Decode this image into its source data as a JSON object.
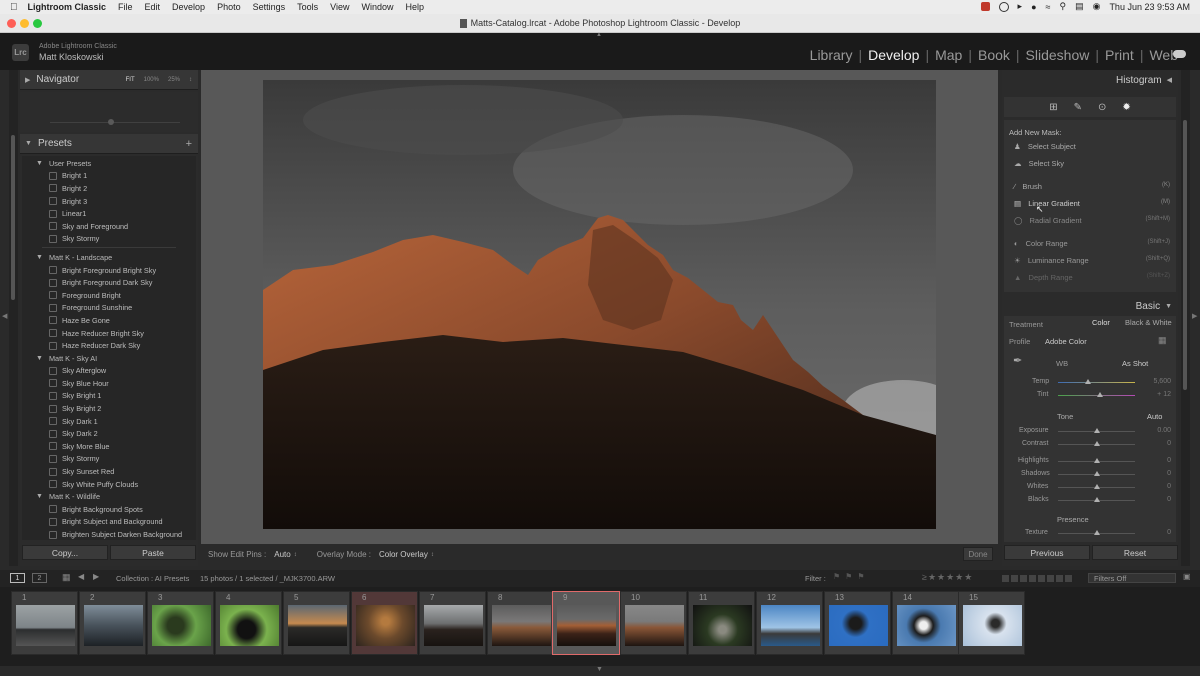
{
  "menubar": {
    "app": "Lightroom Classic",
    "items": [
      "File",
      "Edit",
      "Develop",
      "Photo",
      "Settings",
      "Tools",
      "View",
      "Window",
      "Help"
    ],
    "clock": "Thu Jun 23  9:53 AM"
  },
  "window": {
    "title": "Matts-Catalog.lrcat - Adobe Photoshop Lightroom Classic - Develop"
  },
  "identity": {
    "line1": "Adobe Lightroom Classic",
    "line2": "Matt Kloskowski",
    "logo": "Lrc"
  },
  "modules": [
    "Library",
    "Develop",
    "Map",
    "Book",
    "Slideshow",
    "Print",
    "Web"
  ],
  "active_module": "Develop",
  "left": {
    "navigator": {
      "title": "Navigator",
      "fit": "FIT",
      "z100": "100%",
      "z25": "25%"
    },
    "presets_title": "Presets",
    "preset_groups": [
      {
        "name": "User Presets",
        "items": [
          "Bright 1",
          "Bright 2",
          "Bright 3",
          "Linear1",
          "Sky and Foreground",
          "Sky Stormy"
        ]
      },
      {
        "name": "Matt K - Landscape",
        "items": [
          "Bright Foreground Bright Sky",
          "Bright Foreground Dark Sky",
          "Foreground Bright",
          "Foreground Sunshine",
          "Haze Be Gone",
          "Haze Reducer Bright Sky",
          "Haze Reducer Dark Sky"
        ]
      },
      {
        "name": "Matt K - Sky AI",
        "items": [
          "Sky Afterglow",
          "Sky Blue Hour",
          "Sky Bright 1",
          "Sky Bright 2",
          "Sky Dark 1",
          "Sky Dark 2",
          "Sky More Blue",
          "Sky Stormy",
          "Sky Sunset Red",
          "Sky White Puffy Clouds"
        ]
      },
      {
        "name": "Matt K - Wildlife",
        "items": [
          "Bright Background Spots",
          "Bright Subject and Background",
          "Brighten Subject Darken Background"
        ]
      }
    ],
    "copy_button": "Copy...",
    "paste_button": "Paste"
  },
  "toolbar": {
    "show_edit_pins_label": "Show Edit Pins :",
    "show_edit_pins_value": "Auto",
    "overlay_mode_label": "Overlay Mode :",
    "overlay_mode_value": "Color Overlay",
    "done_button": "Done"
  },
  "right": {
    "histogram_title": "Histogram",
    "add_new_mask": "Add New Mask:",
    "mask_items": [
      {
        "label": "Select Subject",
        "key": ""
      },
      {
        "label": "Select Sky",
        "key": ""
      },
      {
        "label": "Brush",
        "key": "(K)"
      },
      {
        "label": "Linear Gradient",
        "key": "(M)"
      },
      {
        "label": "Radial Gradient",
        "key": "(Shift+M)"
      },
      {
        "label": "Color Range",
        "key": "(Shift+J)"
      },
      {
        "label": "Luminance Range",
        "key": "(Shift+Q)"
      },
      {
        "label": "Depth Range",
        "key": "(Shift+Z)"
      }
    ],
    "basic_title": "Basic",
    "treatment_label": "Treatment",
    "treatment_color": "Color",
    "treatment_bw": "Black & White",
    "profile_label": "Profile",
    "profile_value": "Adobe Color",
    "wb_label": "WB",
    "wb_value": "As Shot",
    "temp": {
      "label": "Temp",
      "value": "5,600",
      "level": 0.5
    },
    "tint": {
      "label": "Tint",
      "value": "+ 12",
      "level": 0.55
    },
    "tone_label": "Tone",
    "tone_auto": "Auto",
    "tone_sliders": [
      {
        "label": "Exposure",
        "value": "0.00",
        "level": 0.5
      },
      {
        "label": "Contrast",
        "value": "0",
        "level": 0.5
      },
      {
        "label": "Highlights",
        "value": "0",
        "level": 0.5
      },
      {
        "label": "Shadows",
        "value": "0",
        "level": 0.5
      },
      {
        "label": "Whites",
        "value": "0",
        "level": 0.5
      },
      {
        "label": "Blacks",
        "value": "0",
        "level": 0.5
      }
    ],
    "presence_label": "Presence",
    "texture": {
      "label": "Texture",
      "value": "0",
      "level": 0.5
    },
    "previous_button": "Previous",
    "reset_button": "Reset"
  },
  "filmstrip_bar": {
    "page1": "1",
    "page2": "2",
    "collection": "Collection : AI Presets",
    "count": "15 photos / 1 selected / _MJK3700.ARW",
    "filter_label": "Filter :",
    "filters_off": "Filters Off"
  },
  "thumbnails": [
    "1",
    "2",
    "3",
    "4",
    "5",
    "6",
    "7",
    "8",
    "9",
    "10",
    "11",
    "12",
    "13",
    "14",
    "15"
  ],
  "colors": {
    "accent_selected": "#e06a6a",
    "panel": "#2b2b2b",
    "background": "#585858"
  }
}
